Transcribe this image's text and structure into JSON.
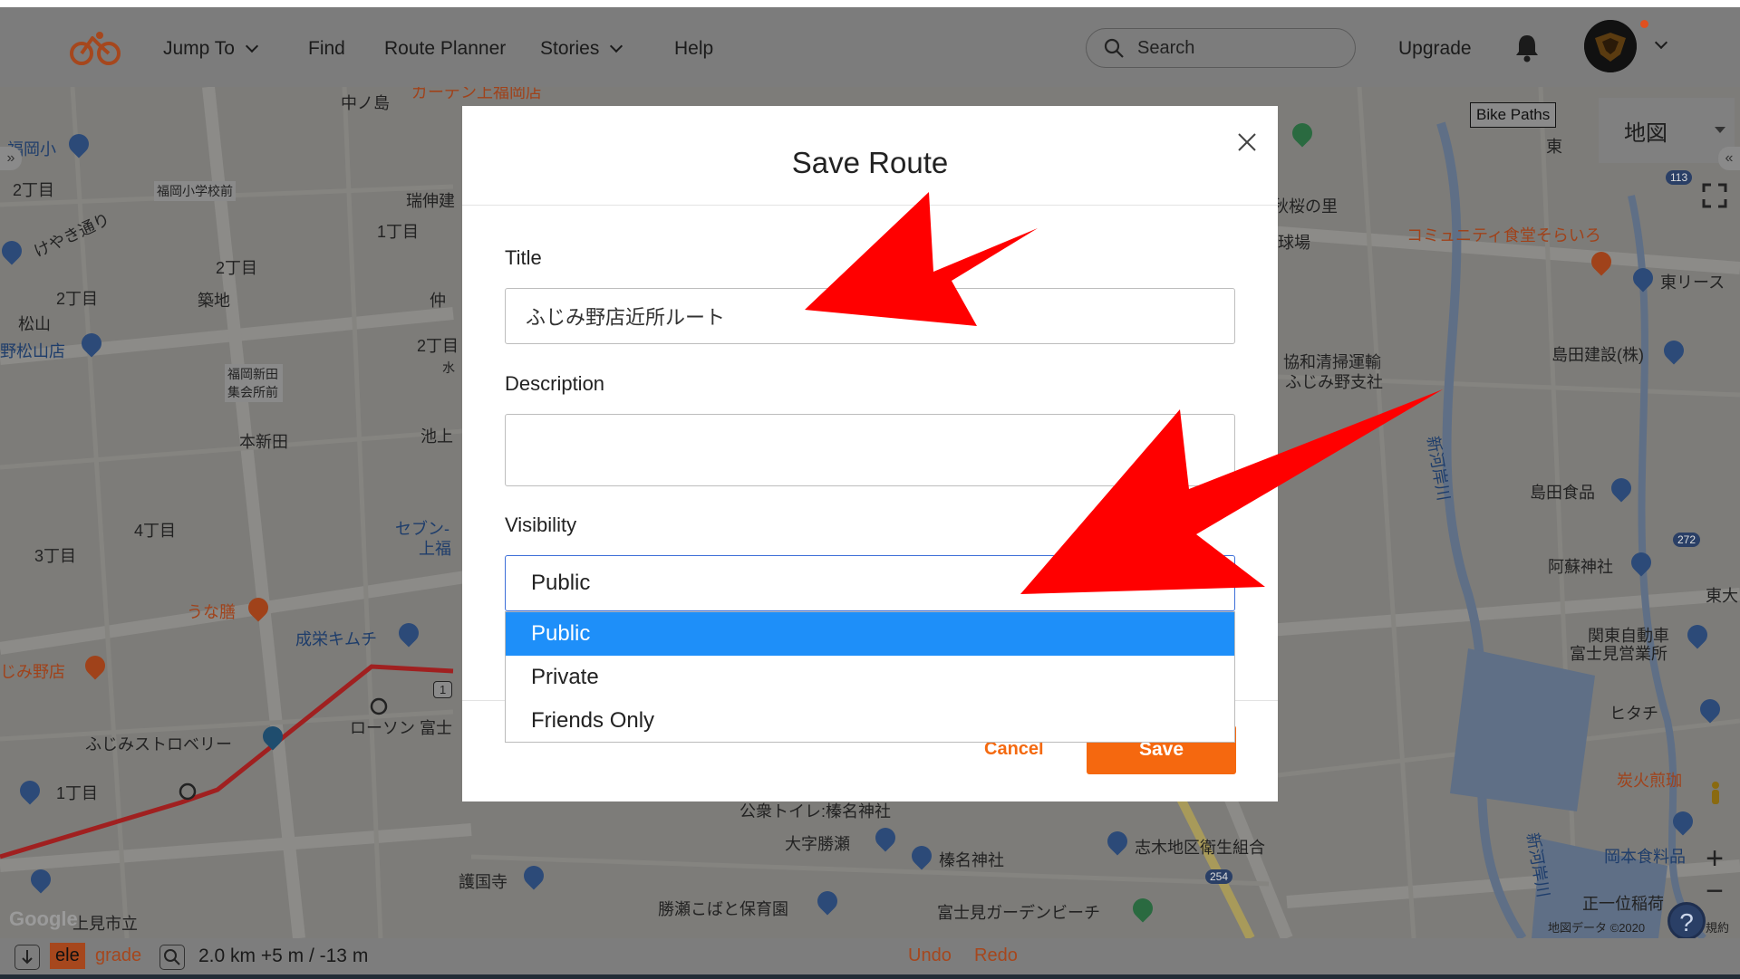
{
  "nav": {
    "items": [
      {
        "label": "Jump To",
        "dropdown": true
      },
      {
        "label": "Find",
        "dropdown": false
      },
      {
        "label": "Route Planner",
        "dropdown": false
      },
      {
        "label": "Stories",
        "dropdown": true
      },
      {
        "label": "Help",
        "dropdown": false
      }
    ],
    "search_placeholder": "Search",
    "upgrade_label": "Upgrade"
  },
  "map": {
    "map_type_label": "地図",
    "bike_paths_label": "Bike Paths",
    "labels": [
      "ガーデン上福岡店",
      "中ノ島",
      "福岡小",
      "2丁目",
      "福岡小学校前",
      "瑞伸建",
      "1丁目",
      "けやき通り",
      "2丁目",
      "築地",
      "2丁目",
      "松山",
      "野松山店",
      "仲",
      "2丁目",
      "水",
      "福岡新田集会所前",
      "本新田",
      "池上",
      "4丁目",
      "3丁目",
      "セブン-",
      "上福",
      "うな膳",
      "成栄キムチ",
      "じみ野店",
      "ふじみストロベリー",
      "ローソン 富士",
      "1丁目",
      "公衆トイレ:榛名神社",
      "大字勝瀬",
      "榛名神社",
      "護国寺",
      "勝瀬こばと保育園",
      "志木地区衛生組合",
      "富士見ガーデンビーチ",
      "上見市立",
      "秋桜の里",
      "球場",
      "コミュニティ食堂そらいろ",
      "東リース",
      "協和清掃運輸",
      "ふじみ野支社",
      "島田建設(株)",
      "新河岸川",
      "島田食品",
      "阿蘇神社",
      "東大",
      "関東自動車",
      "富士見営業所",
      "ヒタチ",
      "炭火煎珈",
      "岡本食料品",
      "正一位稲荷",
      "新河岸川",
      "東",
      "113",
      "272",
      "254",
      "1",
      "Google",
      "地図データ ©2020",
      "規約"
    ]
  },
  "modal": {
    "title": "Save Route",
    "title_label": "Title",
    "title_value": "ふじみ野店近所ルート",
    "description_label": "Description",
    "description_value": "",
    "visibility_label": "Visibility",
    "visibility_value": "Public",
    "visibility_options": [
      "Public",
      "Private",
      "Friends Only"
    ],
    "cancel_label": "Cancel",
    "save_label": "Save"
  },
  "bottom_bar": {
    "ele_label": "ele",
    "grade_label": "grade",
    "stats": "2.0 km +5 m / -13 m",
    "undo_label": "Undo",
    "redo_label": "Redo"
  },
  "colors": {
    "accent": "#f5680f",
    "selected_option": "#1e8ff9",
    "annotation_arrow": "#ff0000"
  }
}
